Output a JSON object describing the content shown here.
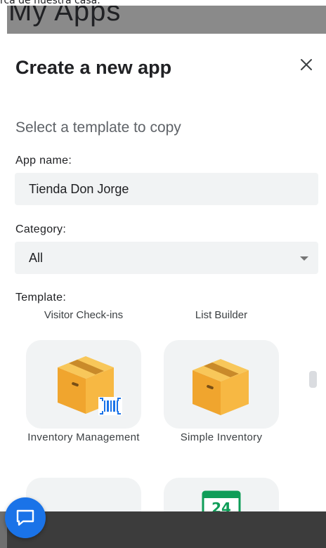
{
  "background": {
    "top_strip_text": "rca de nuestra casa.",
    "page_title": "My Apps"
  },
  "dialog": {
    "title": "Create a new app",
    "subtitle": "Select a template to copy",
    "app_name": {
      "label": "App name:",
      "value": "Tienda Don Jorge"
    },
    "category": {
      "label": "Category:",
      "selected": "All"
    },
    "template": {
      "label": "Template:",
      "partial_row": [
        "Visitor Check-ins",
        "List Builder"
      ],
      "tiles": [
        {
          "name": "Inventory Management",
          "icon": "inventory-box-barcode-icon"
        },
        {
          "name": "Simple Inventory",
          "icon": "inventory-box-icon"
        }
      ],
      "partial_tiles": [
        {
          "icon": "blank-tile"
        },
        {
          "icon": "calendar-24-icon",
          "badge": "24"
        }
      ]
    }
  },
  "colors": {
    "accent": "#1a73e8",
    "field_bg": "#f1f3f4",
    "box": "#f5b53f",
    "barcode": "#1a73e8",
    "calendar_green": "#0f9d58"
  }
}
